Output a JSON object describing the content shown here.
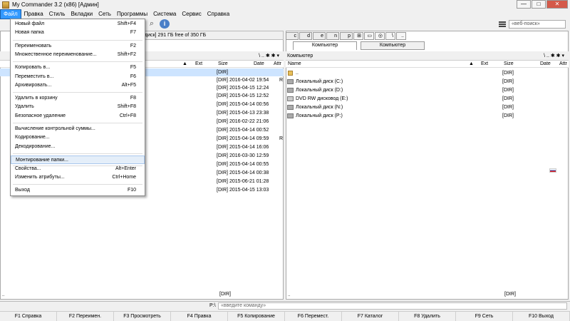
{
  "window": {
    "title": "My Commander 3.2 (x86) [Админ]",
    "minimize": "—",
    "maximize": "□",
    "close": "✕"
  },
  "menu": [
    "Файл",
    "Правка",
    "Стиль",
    "Вкладки",
    "Сеть",
    "Программы",
    "Система",
    "Сервис",
    "Справка"
  ],
  "search": {
    "placeholder": "«веб-поиск»"
  },
  "left_panel": {
    "drive_info": "диск] 291 ГБ free of 350 ГБ",
    "path_tools": "\\ .. ✱ ✱ ▾",
    "columns": {
      "name": "Name",
      "ext": "Ext",
      "size": "Size",
      "date": "Date",
      "attr": "Attr"
    },
    "rows": [
      {
        "size": "[DIR]",
        "date": "",
        "attr": ""
      },
      {
        "size": "[DIR]",
        "date": "2016-04-02 19:54",
        "attr": "R"
      },
      {
        "size": "[DIR]",
        "date": "2015-04-15 12:24",
        "attr": ""
      },
      {
        "size": "[DIR]",
        "date": "2015-04-15 12:52",
        "attr": ""
      },
      {
        "size": "[DIR]",
        "date": "2015-04-14 00:56",
        "attr": ""
      },
      {
        "size": "[DIR]",
        "date": "2015-04-13 23:38",
        "attr": ""
      },
      {
        "size": "[DIR]",
        "date": "2016-02-22 21:06",
        "attr": ""
      },
      {
        "size": "[DIR]",
        "date": "2015-04-14 00:52",
        "attr": ""
      },
      {
        "size": "[DIR]",
        "date": "2015-04-14 09:59",
        "attr": "R"
      },
      {
        "size": "[DIR]",
        "date": "2015-04-14 16:06",
        "attr": ""
      },
      {
        "size": "[DIR]",
        "date": "2016-03-30 12:59",
        "attr": ""
      },
      {
        "size": "[DIR]",
        "date": "2015-04-14 00:55",
        "attr": ""
      },
      {
        "size": "[DIR]",
        "date": "2015-04-14 00:38",
        "attr": ""
      },
      {
        "size": "[DIR]",
        "date": "2015-06-21 01:28",
        "attr": ""
      },
      {
        "size": "[DIR]",
        "date": "2015-04-15 13:03",
        "attr": ""
      }
    ],
    "status": "[DIR]",
    "ticks": ".."
  },
  "right_panel": {
    "tabs": [
      "Компьютер",
      "Компьютер"
    ],
    "drives": [
      "c",
      "d",
      "e",
      "n",
      "p"
    ],
    "path": "Компьютер",
    "columns": {
      "name": "Name",
      "ext": "Ext",
      "size": "Size",
      "date": "Date",
      "attr": "Attr"
    },
    "rows": [
      {
        "name": "..",
        "size": "[DIR]"
      },
      {
        "name": "Локальный диск (C:)",
        "size": "[DIR]"
      },
      {
        "name": "Локальный диск (D:)",
        "size": "[DIR]"
      },
      {
        "name": "DVD RW дисковод (E:)",
        "size": "[DIR]"
      },
      {
        "name": "Локальный диск (N:)",
        "size": "[DIR]"
      },
      {
        "name": "Локальный диск (P:)",
        "size": "[DIR]"
      }
    ],
    "status": "[DIR]",
    "ticks": ".."
  },
  "file_menu": [
    {
      "label": "Новый файл",
      "shortcut": "Shift+F4"
    },
    {
      "label": "Новая папка",
      "shortcut": "F7"
    },
    {
      "label": "Переименовать",
      "shortcut": "F2"
    },
    {
      "label": "Множественное переименование...",
      "shortcut": "Shift+F2"
    },
    {
      "label": "Копировать в...",
      "shortcut": "F5"
    },
    {
      "label": "Переместить в...",
      "shortcut": "F6"
    },
    {
      "label": "Архивировать...",
      "shortcut": "Alt+F5"
    },
    {
      "label": "Удалить в корзину",
      "shortcut": "F8"
    },
    {
      "label": "Удалить",
      "shortcut": "Shift+F8"
    },
    {
      "label": "Безопасное удаление",
      "shortcut": "Ctrl+F8"
    },
    {
      "label": "Вычисление контрольной суммы...",
      "shortcut": ""
    },
    {
      "label": "Кодирование...",
      "shortcut": ""
    },
    {
      "label": "Декодирование...",
      "shortcut": ""
    },
    {
      "label": "Монтирование папки...",
      "shortcut": ""
    },
    {
      "label": "Свойства...",
      "shortcut": "Alt+Enter"
    },
    {
      "label": "Изменить атрибуты...",
      "shortcut": "Ctrl+Home"
    },
    {
      "label": "Выход",
      "shortcut": "F10"
    }
  ],
  "command": {
    "prompt": "P:\\",
    "placeholder": "«введите команду»"
  },
  "fkeys": [
    "F1 Справка",
    "F2 Переимен.",
    "F3 Просмотреть",
    "F4 Правка",
    "F5 Копирование",
    "F6 Перемест.",
    "F7 Каталог",
    "F8 Удалить",
    "F9 Сеть",
    "F10 Выход"
  ]
}
